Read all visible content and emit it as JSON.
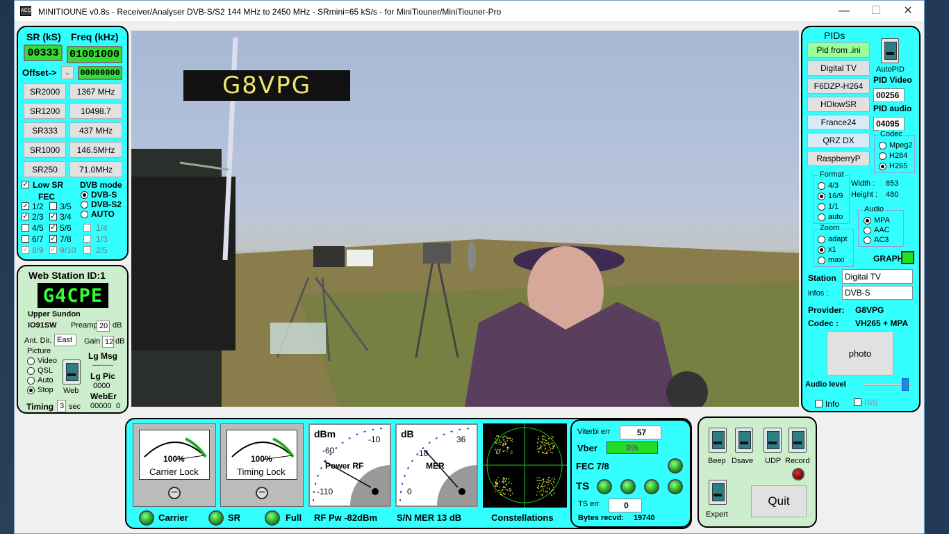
{
  "window": {
    "title": "MINITIOUNE v0.8s - Receiver/Analyser DVB-S/S2 144 MHz to 2450 MHz - SRmini=65 kS/s - for MiniTiouner/MiniTiouner-Pro",
    "app_icon": "ACQ"
  },
  "tuning": {
    "sr_label": "SR (kS)",
    "freq_label": "Freq (kHz)",
    "sr_value": "00333",
    "freq_value": "01001000",
    "offset_label": "Offset->",
    "offset_sign": "-",
    "offset_value": "00000000",
    "sr_buttons": [
      "SR2000",
      "SR1200",
      "SR333",
      "SR1000",
      "SR250"
    ],
    "freq_buttons": [
      "1367 MHz",
      "10498.7",
      "437 MHz",
      "146.5MHz",
      "71.0MHz"
    ],
    "low_sr": "Low SR",
    "fec_label": "FEC",
    "fec_items": [
      {
        "label": "1/2",
        "checked": true,
        "disabled": false
      },
      {
        "label": "3/5",
        "checked": false,
        "disabled": false
      },
      {
        "label": "2/3",
        "checked": true,
        "disabled": false
      },
      {
        "label": "3/4",
        "checked": true,
        "disabled": false
      },
      {
        "label": "4/5",
        "checked": false,
        "disabled": false
      },
      {
        "label": "5/6",
        "checked": true,
        "disabled": false
      },
      {
        "label": "6/7",
        "checked": false,
        "disabled": false
      },
      {
        "label": "7/8",
        "checked": true,
        "disabled": false
      },
      {
        "label": "8/9",
        "checked": true,
        "disabled": true
      },
      {
        "label": "9/10",
        "checked": true,
        "disabled": true
      }
    ],
    "fec_extra": [
      "1/4",
      "1/3",
      "2/5"
    ],
    "dvb_mode_label": "DVB mode",
    "dvb_modes": [
      "DVB-S",
      "DVB-S2",
      "AUTO"
    ]
  },
  "web_station": {
    "title": "Web Station ID:1",
    "callsign": "G4CPE",
    "location": "Upper Sundon",
    "locator": "IO91SW",
    "preamp_label": "Preamp",
    "preamp_value": "20",
    "preamp_unit": "dB",
    "ant_dir_label": "Ant. Dir.",
    "ant_dir_value": "East",
    "gain_label": "Gain",
    "gain_value": "12",
    "gain_unit": "dB",
    "picture_label": "Picture",
    "picture_options": [
      "Video",
      "QSL",
      "Auto",
      "Stop"
    ],
    "web_label": "Web",
    "lg_msg_label": "Lg Msg",
    "lg_msg_value": "----------",
    "lg_pic_label": "Lg Pic",
    "lg_pic_value": "0000",
    "web_er_label": "WebEr",
    "web_er_value": "00000",
    "web_er_value2": "0",
    "timing_label": "Timing",
    "timing_value": "3",
    "timing_unit": "sec"
  },
  "video": {
    "overlay_callsign": "G8VPG"
  },
  "pids": {
    "title": "PIDs",
    "buttons": [
      "Pid from .ini",
      "Digital TV",
      "F6DZP-H264",
      "HDlowSR",
      "France24",
      "QRZ DX",
      "RaspberryP"
    ],
    "autopid_label": "AutoPID",
    "pid_video_label": "PID Video",
    "pid_video_value": "00256",
    "pid_audio_label": "PID audio",
    "pid_audio_value": "04095",
    "codec_label": "Codec",
    "codec_options": [
      "Mpeg2",
      "H264",
      "H265"
    ],
    "format_label": "Format",
    "format_options": [
      "4/3",
      "16/9",
      "1/1",
      "auto"
    ],
    "width_label": "Width :",
    "width_value": "853",
    "height_label": "Height :",
    "height_value": "480",
    "audio_label": "Audio",
    "audio_options": [
      "MPA",
      "AAC",
      "AC3"
    ],
    "zoom_label": "Zoom",
    "zoom_options": [
      "adapt",
      "x1",
      "maxi"
    ],
    "graph_label": "GRAPH",
    "station_label": "Station",
    "station_value": "Digital TV",
    "infos_label": "infos :",
    "infos_value": "DVB-S",
    "provider_label": "Provider:",
    "provider_value": "G8VPG",
    "codec_info_label": "Codec :",
    "codec_info_value": "VH265 + MPA",
    "photo_label": "photo",
    "audio_level_label": "Audio level",
    "audio_level": 0.92,
    "info_label": "Info",
    "iss_label": "ISS"
  },
  "status": {
    "carrier_pct": "100%",
    "carrier_lock": "Carrier Lock",
    "timing_pct": "100%",
    "timing_lock": "Timing Lock",
    "power_unit": "dBm",
    "power_ticks": [
      "-60",
      "-10",
      "-110"
    ],
    "power_label": "Power RF",
    "mer_unit": "dB",
    "mer_ticks": [
      "18",
      "36",
      "0"
    ],
    "mer_label": "MER",
    "carrier_label": "Carrier",
    "sr_label": "SR",
    "full_label": "Full",
    "rf_pw": "RF Pw  -82dBm",
    "sn_mer": "S/N MER   13 dB",
    "constellations_label": "Constellations"
  },
  "errors": {
    "viterbi_label": "Viterbi err",
    "viterbi_value": "57",
    "vber_label": "Vber",
    "vber_value": "0%",
    "fec_label": "FEC 7/8",
    "ts_label": "TS",
    "ts_err_label": "TS err",
    "ts_err_value": "0",
    "bytes_label": "Bytes recvd:",
    "bytes_value": "19740"
  },
  "controls": {
    "beep": "Beep",
    "dsave": "Dsave",
    "udp": "UDP",
    "record": "Record",
    "expert": "Expert",
    "quit": "Quit"
  },
  "window_controls": {
    "minimize": "—",
    "maximize": "☐",
    "close": "✕"
  }
}
